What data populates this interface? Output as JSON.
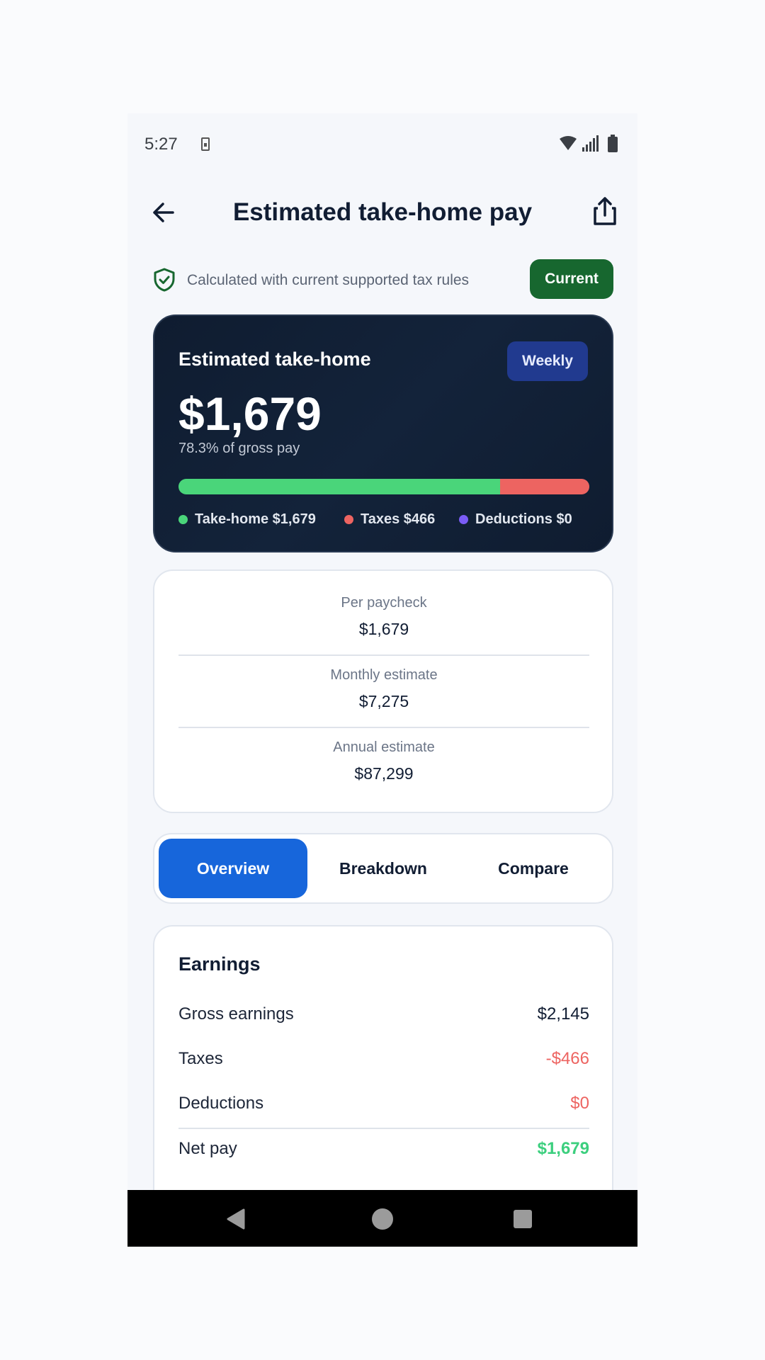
{
  "status_bar": {
    "time": "5:27",
    "icons": [
      "sim-icon",
      "wifi-icon",
      "signal-icon",
      "battery-icon"
    ]
  },
  "header": {
    "title": "Estimated take-home pay",
    "back_icon": "back-arrow-icon",
    "share_icon": "share-icon"
  },
  "tax_notice": {
    "text": "Calculated with current supported tax rules",
    "badge": "Current",
    "icon": "shield-check-icon"
  },
  "hero": {
    "title": "Estimated take-home",
    "period": "Weekly",
    "amount": "$1,679",
    "subtitle": "78.3% of gross pay",
    "bar": {
      "take_home_fraction": 0.783,
      "taxes_fraction": 0.217,
      "deductions_fraction": 0.0
    },
    "legend": [
      {
        "label": "Take-home $1,679",
        "color": "#4ad57a"
      },
      {
        "label": "Taxes $466",
        "color": "#ed6461"
      },
      {
        "label": "Deductions $0",
        "color": "#7a5cf6"
      }
    ]
  },
  "summary": {
    "items": [
      {
        "label": "Per paycheck",
        "value": "$1,679"
      },
      {
        "label": "Monthly estimate",
        "value": "$7,275"
      },
      {
        "label": "Annual estimate",
        "value": "$87,299"
      }
    ]
  },
  "tabs": [
    {
      "label": "Overview",
      "active": true
    },
    {
      "label": "Breakdown",
      "active": false
    },
    {
      "label": "Compare",
      "active": false
    }
  ],
  "earnings": {
    "title": "Earnings",
    "rows": [
      {
        "label": "Gross earnings",
        "value": "$2,145",
        "color": "#111d33"
      },
      {
        "label": "Taxes",
        "value": "-$466",
        "color": "#ed6461"
      },
      {
        "label": "Deductions",
        "value": "$0",
        "color": "#ed6461"
      },
      {
        "label": "Net pay",
        "value": "$1,679",
        "color": "#3ccf7e"
      }
    ]
  },
  "colors": {
    "accent": "#1766db",
    "success": "#17672f",
    "hero_bg": "#0f1c30"
  },
  "nav_bar": {
    "icons": [
      "nav-back-icon",
      "nav-home-icon",
      "nav-recents-icon"
    ]
  }
}
